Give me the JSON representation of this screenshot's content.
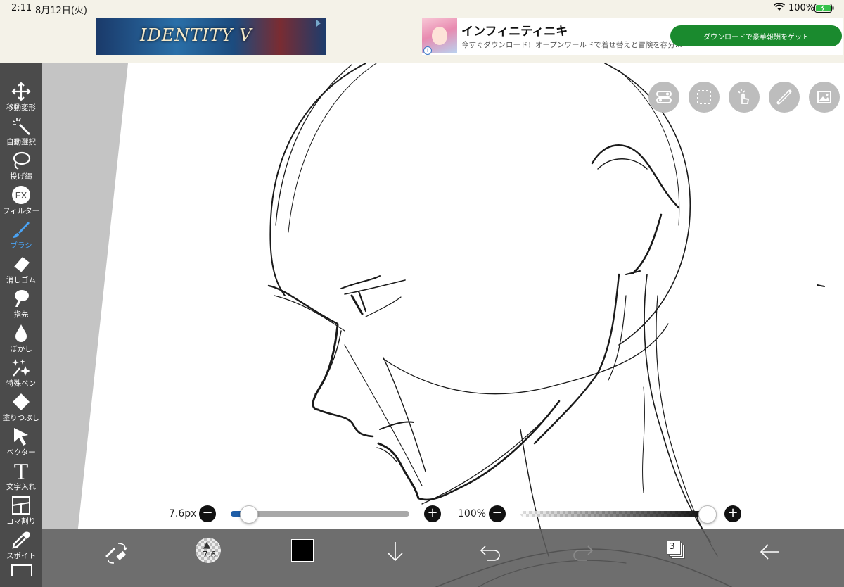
{
  "status_bar": {
    "time": "2:11",
    "date": "8月12日(火)",
    "battery_text": "100%",
    "battery_icon": "battery-charging-icon",
    "wifi_icon": "wifi-icon"
  },
  "ads": {
    "left_banner_logo": "IDENTITY V",
    "right_title": "インフィニティニキ",
    "right_sub": "今すぐダウンロード！オープンワールドで着せ替えと冒険を存分...",
    "right_button": "ダウンロードで豪華報酬をゲット",
    "info_badge": "i"
  },
  "toolbar": {
    "items": [
      {
        "label": "移動変形",
        "icon": "move-icon"
      },
      {
        "label": "自動選択",
        "icon": "magic-wand-icon"
      },
      {
        "label": "投げ縄",
        "icon": "lasso-icon"
      },
      {
        "label": "フィルター",
        "icon": "fx-icon",
        "glyph": "FX"
      },
      {
        "label": "ブラシ",
        "icon": "brush-icon",
        "active": true
      },
      {
        "label": "消しゴム",
        "icon": "eraser-icon"
      },
      {
        "label": "指先",
        "icon": "finger-icon"
      },
      {
        "label": "ぼかし",
        "icon": "blur-icon"
      },
      {
        "label": "特殊ペン",
        "icon": "special-pen-icon"
      },
      {
        "label": "塗りつぶし",
        "icon": "fill-icon"
      },
      {
        "label": "ベクター",
        "icon": "vector-icon"
      },
      {
        "label": "文字入れ",
        "icon": "text-icon",
        "glyph": "T"
      },
      {
        "label": "コマ割り",
        "icon": "frame-icon"
      },
      {
        "label": "スポイト",
        "icon": "eyedropper-icon"
      }
    ]
  },
  "top_controls": [
    {
      "icon": "toggle-panel-icon"
    },
    {
      "icon": "selection-icon"
    },
    {
      "icon": "touch-gesture-icon"
    },
    {
      "icon": "ruler-icon"
    },
    {
      "icon": "image-icon"
    }
  ],
  "brush_size": {
    "label": "7.6px",
    "value": 7.6,
    "fraction": 0.1,
    "minus": "−",
    "plus": "+"
  },
  "opacity": {
    "label": "100%",
    "value": 100,
    "fraction": 1.0,
    "minus": "−",
    "plus": "+"
  },
  "bottom_bar": {
    "brush_size_value": "7.6",
    "layer_count": "3",
    "current_color": "#000000",
    "icons": [
      "swap-brush-eraser-icon",
      "brush-size-icon",
      "color-icon",
      "download-icon",
      "undo-icon",
      "redo-icon",
      "layers-icon",
      "back-icon"
    ]
  },
  "colors": {
    "toolbar_bg": "#4b4b4b",
    "active_tool": "#4aa3f4",
    "canvas_margin": "#c4c4c4",
    "ad_button": "#1a8a2e",
    "slider_fill": "#1f5ea8"
  }
}
